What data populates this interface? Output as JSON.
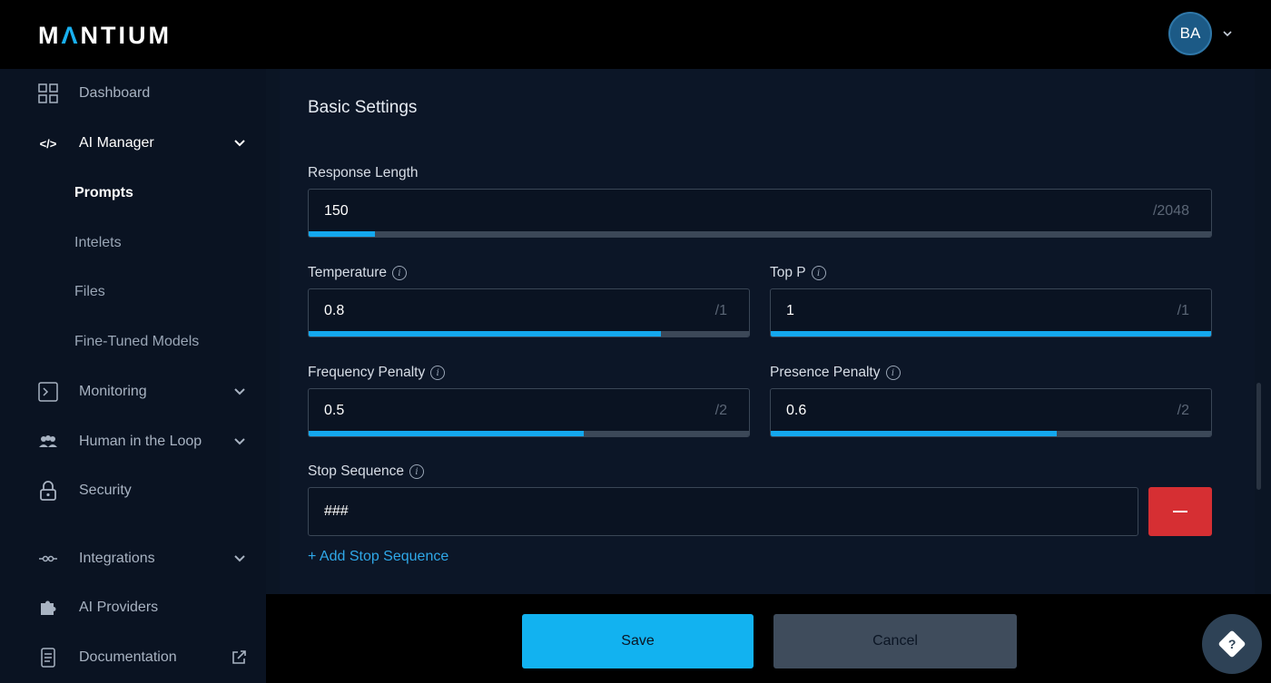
{
  "header": {
    "logo_text": "MΛNTIUM",
    "user_initials": "BA"
  },
  "sidebar": {
    "items": [
      {
        "label": "Dashboard",
        "icon": "grid-icon"
      },
      {
        "label": "AI Manager",
        "icon": "code-icon"
      },
      {
        "label": "Monitoring",
        "icon": "terminal-icon"
      },
      {
        "label": "Human in the Loop",
        "icon": "people-icon"
      },
      {
        "label": "Security",
        "icon": "lock-icon"
      },
      {
        "label": "Integrations",
        "icon": "plug-icon"
      },
      {
        "label": "AI Providers",
        "icon": "puzzle-icon"
      },
      {
        "label": "Documentation",
        "icon": "document-icon"
      }
    ],
    "ai_manager_sub": [
      "Prompts",
      "Intelets",
      "Files",
      "Fine-Tuned Models"
    ]
  },
  "basic_settings": {
    "title": "Basic Settings",
    "response_length": {
      "label": "Response Length",
      "value": "150",
      "max": "/2048",
      "fill_fraction": 0.073
    },
    "temperature": {
      "label": "Temperature",
      "value": "0.8",
      "max": "/1",
      "fill_fraction": 0.8
    },
    "top_p": {
      "label": "Top P",
      "value": "1",
      "max": "/1",
      "fill_fraction": 1.0
    },
    "frequency_penalty": {
      "label": "Frequency Penalty",
      "value": "0.5",
      "max": "/2",
      "fill_fraction": 0.625
    },
    "presence_penalty": {
      "label": "Presence Penalty",
      "value": "0.6",
      "max": "/2",
      "fill_fraction": 0.65
    },
    "stop_sequence": {
      "label": "Stop Sequence",
      "value": "###",
      "add_label": "+ Add Stop Sequence"
    }
  },
  "footer": {
    "save_label": "Save",
    "cancel_label": "Cancel"
  },
  "colors": {
    "accent": "#14a8ee",
    "danger": "#d62f33"
  }
}
